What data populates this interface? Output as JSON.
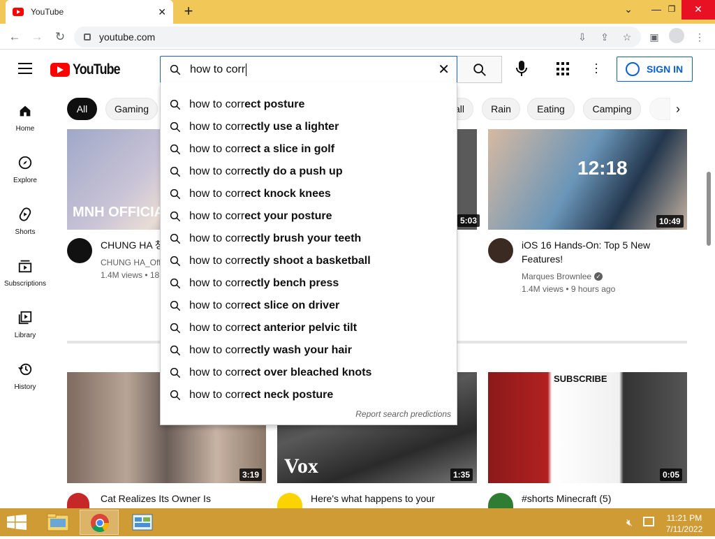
{
  "browser": {
    "tab_title": "YouTube",
    "url": "youtube.com"
  },
  "youtube": {
    "logo_text": "YouTube",
    "search_query": "how to corr",
    "sign_in_label": "SIGN IN"
  },
  "chips": [
    "All",
    "Gaming",
    "all",
    "Rain",
    "Eating",
    "Camping"
  ],
  "sidebar": [
    {
      "label": "Home",
      "icon": "home-icon"
    },
    {
      "label": "Explore",
      "icon": "compass-icon"
    },
    {
      "label": "Shorts",
      "icon": "shorts-icon"
    },
    {
      "label": "Subscriptions",
      "icon": "subscriptions-icon"
    },
    {
      "label": "Library",
      "icon": "library-icon"
    },
    {
      "label": "History",
      "icon": "history-icon"
    }
  ],
  "suggestions": [
    {
      "typed": "how to corr",
      "rest": "ect posture"
    },
    {
      "typed": "how to corr",
      "rest": "ectly use a lighter"
    },
    {
      "typed": "how to corr",
      "rest": "ect a slice in golf"
    },
    {
      "typed": "how to corr",
      "rest": "ectly do a push up"
    },
    {
      "typed": "how to corr",
      "rest": "ect knock knees"
    },
    {
      "typed": "how to corr",
      "rest": "ect your posture"
    },
    {
      "typed": "how to corr",
      "rest": "ectly brush your teeth"
    },
    {
      "typed": "how to corr",
      "rest": "ectly shoot a basketball"
    },
    {
      "typed": "how to corr",
      "rest": "ectly bench press"
    },
    {
      "typed": "how to corr",
      "rest": "ect slice on driver"
    },
    {
      "typed": "how to corr",
      "rest": "ect anterior pelvic tilt"
    },
    {
      "typed": "how to corr",
      "rest": "ectly wash your hair"
    },
    {
      "typed": "how to corr",
      "rest": "ect over bleached knots"
    },
    {
      "typed": "how to corr",
      "rest": "ect neck posture"
    }
  ],
  "report_label": "Report search predictions",
  "videos": [
    {
      "title": "CHUNG HA 청",
      "channel": "CHUNG HA_Offi",
      "meta": "1.4M views • 18",
      "duration": "",
      "thumb_text": "MNH OFFICIAL"
    },
    {
      "title": "",
      "channel": "",
      "meta": "",
      "duration": "5:03"
    },
    {
      "title": "iOS 16 Hands-On: Top 5 New Features!",
      "channel": "Marques Brownlee",
      "meta": "1.4M views • 9 hours ago",
      "duration": "10:49",
      "thumb_text": "12:18"
    },
    {
      "title": "Cat Realizes Its Owner Is",
      "duration": "3:19"
    },
    {
      "title": "Here's what happens to your",
      "duration": "1:35",
      "thumb_text": "Vox"
    },
    {
      "title": "#shorts Minecraft (5)",
      "duration": "0:05",
      "thumb_text": "SUBSCRIBE"
    }
  ],
  "taskbar": {
    "time": "11:21 PM",
    "date": "7/11/2022"
  }
}
